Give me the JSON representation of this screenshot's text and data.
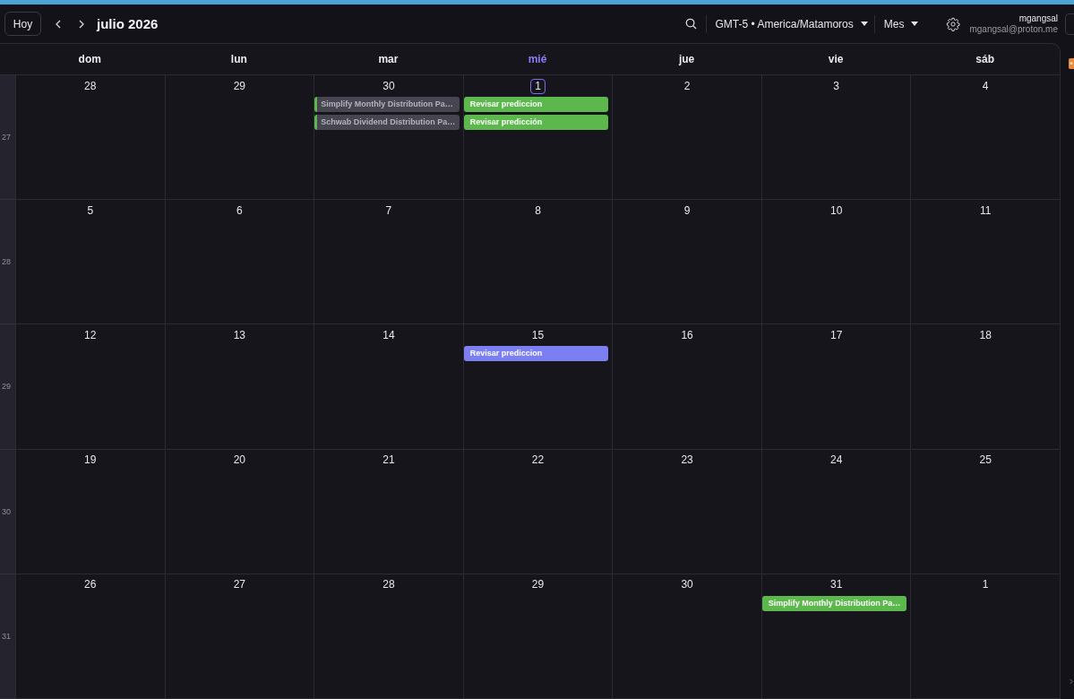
{
  "toolbar": {
    "today_button": "Hoy",
    "title": "julio 2026",
    "timezone": "GMT-5 • America/Matamoros",
    "view": "Mes",
    "user": {
      "name": "mgangsal",
      "email": "mgangsal@proton.me"
    }
  },
  "weekdays": [
    {
      "label": "dom",
      "today": false
    },
    {
      "label": "lun",
      "today": false
    },
    {
      "label": "mar",
      "today": false
    },
    {
      "label": "mié",
      "today": true
    },
    {
      "label": "jue",
      "today": false
    },
    {
      "label": "vie",
      "today": false
    },
    {
      "label": "sáb",
      "today": false
    }
  ],
  "weeks": [
    {
      "number": "27",
      "days": [
        {
          "date": "28",
          "today": false
        },
        {
          "date": "29",
          "today": false
        },
        {
          "date": "30",
          "today": false,
          "events": [
            {
              "title": "Simplify Monthly Distribution Pa…",
              "color": "#5cb84d",
              "past": true
            },
            {
              "title": "Schwab Dividend Distribution Pa…",
              "color": "#5cb84d",
              "past": true
            }
          ]
        },
        {
          "date": "1",
          "today": true,
          "events": [
            {
              "title": "Revisar prediccion",
              "color": "#5cb84d",
              "past": false
            },
            {
              "title": "Revisar predicción",
              "color": "#5cb84d",
              "past": false
            }
          ]
        },
        {
          "date": "2",
          "today": false
        },
        {
          "date": "3",
          "today": false
        },
        {
          "date": "4",
          "today": false
        }
      ]
    },
    {
      "number": "28",
      "days": [
        {
          "date": "5",
          "today": false
        },
        {
          "date": "6",
          "today": false
        },
        {
          "date": "7",
          "today": false
        },
        {
          "date": "8",
          "today": false
        },
        {
          "date": "9",
          "today": false
        },
        {
          "date": "10",
          "today": false
        },
        {
          "date": "11",
          "today": false
        }
      ]
    },
    {
      "number": "29",
      "days": [
        {
          "date": "12",
          "today": false
        },
        {
          "date": "13",
          "today": false
        },
        {
          "date": "14",
          "today": false
        },
        {
          "date": "15",
          "today": false,
          "events": [
            {
              "title": "Revisar prediccion",
              "color": "#7c7ff2",
              "past": false
            }
          ]
        },
        {
          "date": "16",
          "today": false
        },
        {
          "date": "17",
          "today": false
        },
        {
          "date": "18",
          "today": false
        }
      ]
    },
    {
      "number": "30",
      "days": [
        {
          "date": "19",
          "today": false
        },
        {
          "date": "20",
          "today": false
        },
        {
          "date": "21",
          "today": false
        },
        {
          "date": "22",
          "today": false
        },
        {
          "date": "23",
          "today": false
        },
        {
          "date": "24",
          "today": false
        },
        {
          "date": "25",
          "today": false
        }
      ]
    },
    {
      "number": "31",
      "days": [
        {
          "date": "26",
          "today": false
        },
        {
          "date": "27",
          "today": false
        },
        {
          "date": "28",
          "today": false
        },
        {
          "date": "29",
          "today": false
        },
        {
          "date": "30",
          "today": false
        },
        {
          "date": "31",
          "today": false,
          "events": [
            {
              "title": "Simplify Monthly Distribution Pa…",
              "color": "#5cb84d",
              "past": false
            }
          ]
        },
        {
          "date": "1",
          "today": false
        }
      ]
    }
  ]
}
